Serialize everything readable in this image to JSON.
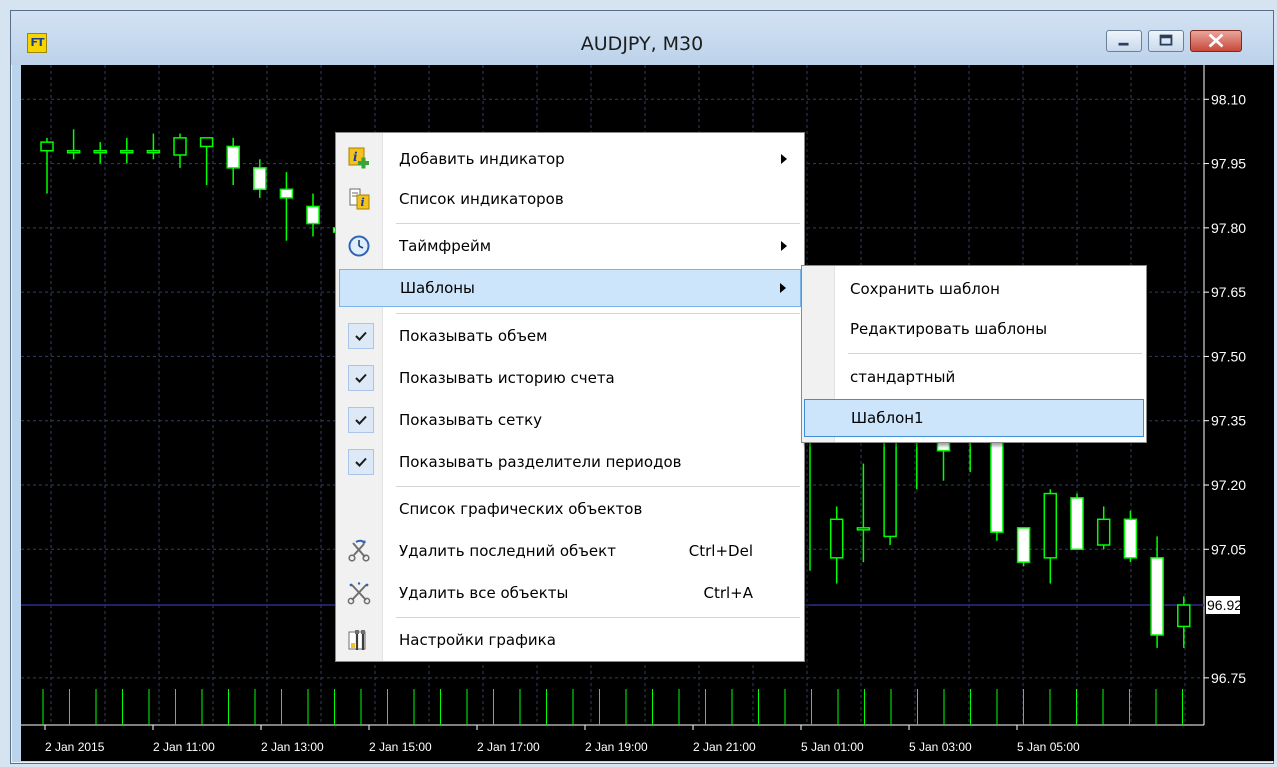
{
  "window": {
    "title": "AUDJPY, M30",
    "app_icon_text": "FT",
    "icons": {
      "app": "ft-app-icon",
      "minimize": "minimize-icon",
      "maximize": "maximize-icon",
      "close": "close-icon"
    }
  },
  "chart": {
    "symbol": "AUDJPY",
    "timeframe": "M30",
    "background_color": "#000000",
    "candle_color": "#00ff00",
    "grid_color": "#2f3f66",
    "bid_line_color": "#2b2f8a",
    "current_price": "96.92",
    "price_axis": [
      "98.10",
      "97.95",
      "97.80",
      "97.65",
      "97.50",
      "97.35",
      "97.20",
      "97.05",
      "96.75"
    ],
    "time_axis": [
      "2 Jan 2015",
      "2 Jan 11:00",
      "2 Jan 13:00",
      "2 Jan 15:00",
      "2 Jan 17:00",
      "2 Jan 19:00",
      "2 Jan 21:00",
      "5 Jan 01:00",
      "5 Jan 03:00",
      "5 Jan 05:00"
    ]
  },
  "chart_data": {
    "type": "candlestick",
    "ylim": [
      96.64,
      98.18
    ],
    "candles_left": [
      {
        "o": 97.98,
        "h": 98.01,
        "l": 97.88,
        "c": 98.0
      },
      {
        "o": 97.98,
        "h": 98.03,
        "l": 97.96,
        "c": 97.98
      },
      {
        "o": 97.98,
        "h": 98.0,
        "l": 97.95,
        "c": 97.98
      },
      {
        "o": 97.98,
        "h": 98.01,
        "l": 97.95,
        "c": 97.98
      },
      {
        "o": 97.98,
        "h": 98.02,
        "l": 97.96,
        "c": 97.98
      },
      {
        "o": 97.97,
        "h": 98.02,
        "l": 97.94,
        "c": 98.01
      },
      {
        "o": 97.99,
        "h": 98.01,
        "l": 97.9,
        "c": 98.01
      },
      {
        "o": 97.99,
        "h": 98.01,
        "l": 97.9,
        "c": 97.94
      },
      {
        "o": 97.94,
        "h": 97.96,
        "l": 97.87,
        "c": 97.89
      },
      {
        "o": 97.89,
        "h": 97.93,
        "l": 97.77,
        "c": 97.87
      },
      {
        "o": 97.85,
        "h": 97.88,
        "l": 97.78,
        "c": 97.81
      },
      {
        "o": 97.8,
        "h": 97.84,
        "l": 97.77,
        "c": 97.79
      },
      {
        "o": 97.78,
        "h": 97.84,
        "l": 97.76,
        "c": 97.82
      }
    ],
    "candles_right": [
      {
        "o": 97.33,
        "h": 97.42,
        "l": 97.0,
        "c": 97.33
      },
      {
        "o": 97.03,
        "h": 97.15,
        "l": 96.97,
        "c": 97.12
      },
      {
        "o": 97.1,
        "h": 97.25,
        "l": 97.02,
        "c": 97.1
      },
      {
        "o": 97.08,
        "h": 97.36,
        "l": 97.06,
        "c": 97.36
      },
      {
        "o": 97.35,
        "h": 97.38,
        "l": 97.19,
        "c": 97.36
      },
      {
        "o": 97.35,
        "h": 97.38,
        "l": 97.21,
        "c": 97.28
      },
      {
        "o": 97.3,
        "h": 97.37,
        "l": 97.23,
        "c": 97.34
      },
      {
        "o": 97.36,
        "h": 97.38,
        "l": 97.07,
        "c": 97.09
      },
      {
        "o": 97.1,
        "h": 97.1,
        "l": 97.01,
        "c": 97.02
      },
      {
        "o": 97.03,
        "h": 97.19,
        "l": 96.97,
        "c": 97.18
      },
      {
        "o": 97.17,
        "h": 97.18,
        "l": 97.05,
        "c": 97.05
      },
      {
        "o": 97.06,
        "h": 97.15,
        "l": 97.05,
        "c": 97.12
      },
      {
        "o": 97.12,
        "h": 97.14,
        "l": 97.02,
        "c": 97.03
      },
      {
        "o": 97.03,
        "h": 97.08,
        "l": 96.82,
        "c": 96.85
      },
      {
        "o": 96.87,
        "h": 96.94,
        "l": 96.82,
        "c": 96.92
      }
    ]
  },
  "context_menu": {
    "items": [
      {
        "label": "Добавить индикатор",
        "icon": "add-indicator-icon",
        "submenu": true
      },
      {
        "label": "Список индикаторов",
        "icon": "indicator-list-icon"
      },
      {
        "label": "Таймфрейм",
        "icon": "clock-icon",
        "submenu": true
      },
      {
        "label": "Шаблоны",
        "submenu": true,
        "highlighted": true
      },
      {
        "label": "Показывать объем",
        "checked": true
      },
      {
        "label": "Показывать историю счета",
        "checked": true
      },
      {
        "label": "Показывать сетку",
        "checked": true
      },
      {
        "label": "Показывать разделители периодов",
        "checked": true
      },
      {
        "label": "Список графических объектов"
      },
      {
        "label": "Удалить последний объект",
        "icon": "delete-last-object-icon",
        "shortcut": "Ctrl+Del"
      },
      {
        "label": "Удалить все объекты",
        "icon": "delete-all-objects-icon",
        "shortcut": "Ctrl+A"
      },
      {
        "label": "Настройки графика",
        "icon": "chart-settings-icon"
      }
    ]
  },
  "templates_submenu": {
    "items": [
      {
        "label": "Сохранить шаблон"
      },
      {
        "label": "Редактировать шаблоны"
      },
      {
        "label": "стандартный"
      },
      {
        "label": "Шаблон1",
        "highlighted": true
      }
    ]
  },
  "colors": {
    "menu_highlight": "#cde5fb",
    "menu_highlight_border": "#79b4e8",
    "check_background": "#dde9f7"
  }
}
